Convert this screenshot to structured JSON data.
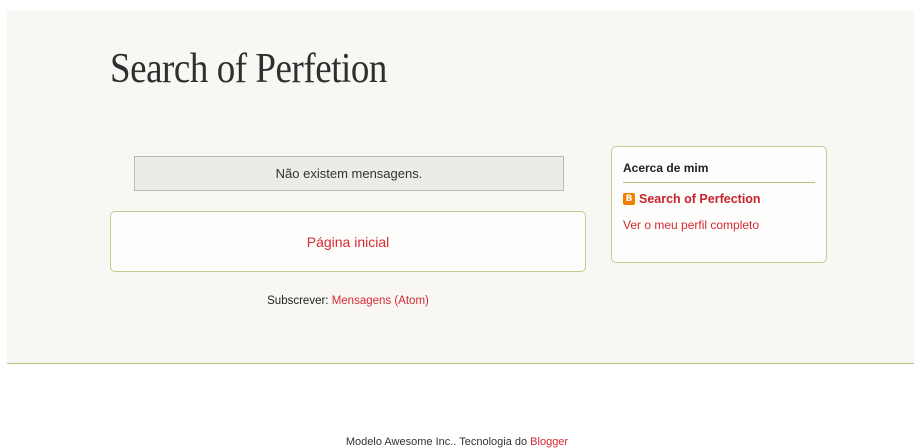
{
  "header": {
    "blog_title": "Search of Perfetion"
  },
  "main": {
    "no_posts_message": "Não existem mensagens.",
    "home_link": "Página inicial",
    "subscribe_label": "Subscrever:",
    "subscribe_link": "Mensagens (Atom)"
  },
  "sidebar": {
    "widget_title": "Acerca de mim",
    "profile_icon": "blogger-icon",
    "profile_name": "Search of Perfection",
    "full_profile_link": "Ver o meu perfil completo"
  },
  "footer": {
    "template_text": "Modelo Awesome Inc.. Tecnologia do",
    "blogger_link": "Blogger"
  },
  "colors": {
    "link": "#d52a33",
    "accent_border": "#b8c27a",
    "background": "#f8f7f4"
  }
}
